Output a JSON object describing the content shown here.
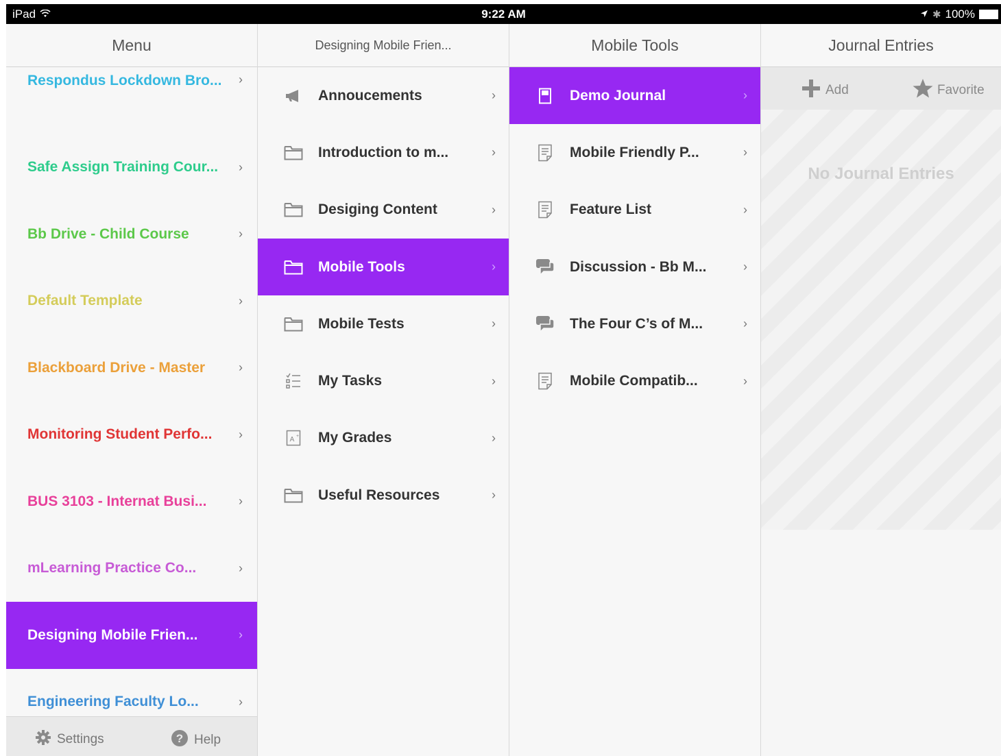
{
  "status_bar": {
    "device": "iPad",
    "time": "9:22 AM",
    "battery": "100%"
  },
  "menu": {
    "header": "Menu",
    "items": [
      {
        "label": "Respondus Lockdown Bro...",
        "color": "#35b8e0"
      },
      {
        "label": "Safe Assign Training Cour...",
        "color": "#2ecc8c"
      },
      {
        "label": "Bb Drive - Child Course",
        "color": "#5cc84a"
      },
      {
        "label": "Default Template",
        "color": "#d4cc5a"
      },
      {
        "label": "Blackboard Drive - Master",
        "color": "#eba03a"
      },
      {
        "label": "Monitoring Student Perfo...",
        "color": "#e03535"
      },
      {
        "label": "BUS 3103 - Internat Busi...",
        "color": "#e8409a"
      },
      {
        "label": "mLearning Practice Co...",
        "color": "#c75bd6"
      },
      {
        "label": "Designing Mobile Frien...",
        "color": "#ffffff",
        "active": true
      },
      {
        "label": "Engineering Faculty Lo...",
        "color": "#3f8fd6"
      }
    ],
    "footer": {
      "settings_label": "Settings",
      "help_label": "Help"
    }
  },
  "course": {
    "header": "Designing Mobile Frien...",
    "items": [
      {
        "label": "Annoucements",
        "icon": "megaphone-icon"
      },
      {
        "label": "Introduction to m...",
        "icon": "folder-icon"
      },
      {
        "label": "Desiging Content",
        "icon": "folder-icon"
      },
      {
        "label": "Mobile Tools",
        "icon": "folder-icon",
        "active": true
      },
      {
        "label": "Mobile Tests",
        "icon": "folder-icon"
      },
      {
        "label": "My Tasks",
        "icon": "tasks-icon"
      },
      {
        "label": "My Grades",
        "icon": "grades-icon"
      },
      {
        "label": "Useful Resources",
        "icon": "folder-icon"
      }
    ]
  },
  "mobile_tools": {
    "header": "Mobile Tools",
    "items": [
      {
        "label": "Demo Journal",
        "icon": "journal-icon",
        "active": true
      },
      {
        "label": "Mobile Friendly P...",
        "icon": "document-icon"
      },
      {
        "label": "Feature List",
        "icon": "document-icon"
      },
      {
        "label": "Discussion - Bb M...",
        "icon": "discussion-icon"
      },
      {
        "label": "The Four C’s of M...",
        "icon": "discussion-icon"
      },
      {
        "label": "Mobile Compatib...",
        "icon": "document-icon"
      }
    ]
  },
  "journal": {
    "header": "Journal Entries",
    "add_label": "Add",
    "favorite_label": "Favorite",
    "empty_text": "No Journal Entries"
  },
  "colors": {
    "accent": "#9728f2"
  }
}
